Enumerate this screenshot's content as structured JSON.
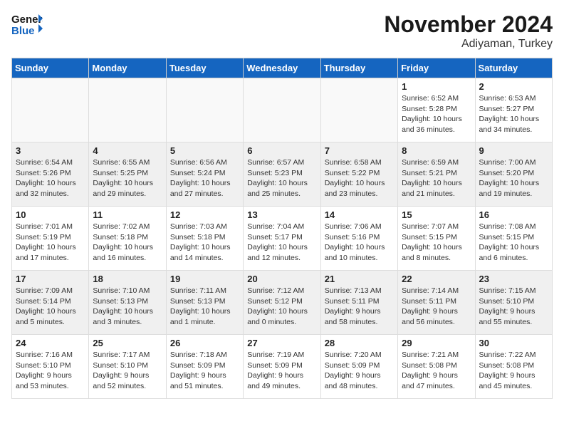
{
  "logo": {
    "general": "General",
    "blue": "Blue"
  },
  "header": {
    "month": "November 2024",
    "location": "Adiyaman, Turkey"
  },
  "weekdays": [
    "Sunday",
    "Monday",
    "Tuesday",
    "Wednesday",
    "Thursday",
    "Friday",
    "Saturday"
  ],
  "weeks": [
    [
      {
        "day": "",
        "info": ""
      },
      {
        "day": "",
        "info": ""
      },
      {
        "day": "",
        "info": ""
      },
      {
        "day": "",
        "info": ""
      },
      {
        "day": "",
        "info": ""
      },
      {
        "day": "1",
        "info": "Sunrise: 6:52 AM\nSunset: 5:28 PM\nDaylight: 10 hours\nand 36 minutes."
      },
      {
        "day": "2",
        "info": "Sunrise: 6:53 AM\nSunset: 5:27 PM\nDaylight: 10 hours\nand 34 minutes."
      }
    ],
    [
      {
        "day": "3",
        "info": "Sunrise: 6:54 AM\nSunset: 5:26 PM\nDaylight: 10 hours\nand 32 minutes."
      },
      {
        "day": "4",
        "info": "Sunrise: 6:55 AM\nSunset: 5:25 PM\nDaylight: 10 hours\nand 29 minutes."
      },
      {
        "day": "5",
        "info": "Sunrise: 6:56 AM\nSunset: 5:24 PM\nDaylight: 10 hours\nand 27 minutes."
      },
      {
        "day": "6",
        "info": "Sunrise: 6:57 AM\nSunset: 5:23 PM\nDaylight: 10 hours\nand 25 minutes."
      },
      {
        "day": "7",
        "info": "Sunrise: 6:58 AM\nSunset: 5:22 PM\nDaylight: 10 hours\nand 23 minutes."
      },
      {
        "day": "8",
        "info": "Sunrise: 6:59 AM\nSunset: 5:21 PM\nDaylight: 10 hours\nand 21 minutes."
      },
      {
        "day": "9",
        "info": "Sunrise: 7:00 AM\nSunset: 5:20 PM\nDaylight: 10 hours\nand 19 minutes."
      }
    ],
    [
      {
        "day": "10",
        "info": "Sunrise: 7:01 AM\nSunset: 5:19 PM\nDaylight: 10 hours\nand 17 minutes."
      },
      {
        "day": "11",
        "info": "Sunrise: 7:02 AM\nSunset: 5:18 PM\nDaylight: 10 hours\nand 16 minutes."
      },
      {
        "day": "12",
        "info": "Sunrise: 7:03 AM\nSunset: 5:18 PM\nDaylight: 10 hours\nand 14 minutes."
      },
      {
        "day": "13",
        "info": "Sunrise: 7:04 AM\nSunset: 5:17 PM\nDaylight: 10 hours\nand 12 minutes."
      },
      {
        "day": "14",
        "info": "Sunrise: 7:06 AM\nSunset: 5:16 PM\nDaylight: 10 hours\nand 10 minutes."
      },
      {
        "day": "15",
        "info": "Sunrise: 7:07 AM\nSunset: 5:15 PM\nDaylight: 10 hours\nand 8 minutes."
      },
      {
        "day": "16",
        "info": "Sunrise: 7:08 AM\nSunset: 5:15 PM\nDaylight: 10 hours\nand 6 minutes."
      }
    ],
    [
      {
        "day": "17",
        "info": "Sunrise: 7:09 AM\nSunset: 5:14 PM\nDaylight: 10 hours\nand 5 minutes."
      },
      {
        "day": "18",
        "info": "Sunrise: 7:10 AM\nSunset: 5:13 PM\nDaylight: 10 hours\nand 3 minutes."
      },
      {
        "day": "19",
        "info": "Sunrise: 7:11 AM\nSunset: 5:13 PM\nDaylight: 10 hours\nand 1 minute."
      },
      {
        "day": "20",
        "info": "Sunrise: 7:12 AM\nSunset: 5:12 PM\nDaylight: 10 hours\nand 0 minutes."
      },
      {
        "day": "21",
        "info": "Sunrise: 7:13 AM\nSunset: 5:11 PM\nDaylight: 9 hours\nand 58 minutes."
      },
      {
        "day": "22",
        "info": "Sunrise: 7:14 AM\nSunset: 5:11 PM\nDaylight: 9 hours\nand 56 minutes."
      },
      {
        "day": "23",
        "info": "Sunrise: 7:15 AM\nSunset: 5:10 PM\nDaylight: 9 hours\nand 55 minutes."
      }
    ],
    [
      {
        "day": "24",
        "info": "Sunrise: 7:16 AM\nSunset: 5:10 PM\nDaylight: 9 hours\nand 53 minutes."
      },
      {
        "day": "25",
        "info": "Sunrise: 7:17 AM\nSunset: 5:10 PM\nDaylight: 9 hours\nand 52 minutes."
      },
      {
        "day": "26",
        "info": "Sunrise: 7:18 AM\nSunset: 5:09 PM\nDaylight: 9 hours\nand 51 minutes."
      },
      {
        "day": "27",
        "info": "Sunrise: 7:19 AM\nSunset: 5:09 PM\nDaylight: 9 hours\nand 49 minutes."
      },
      {
        "day": "28",
        "info": "Sunrise: 7:20 AM\nSunset: 5:09 PM\nDaylight: 9 hours\nand 48 minutes."
      },
      {
        "day": "29",
        "info": "Sunrise: 7:21 AM\nSunset: 5:08 PM\nDaylight: 9 hours\nand 47 minutes."
      },
      {
        "day": "30",
        "info": "Sunrise: 7:22 AM\nSunset: 5:08 PM\nDaylight: 9 hours\nand 45 minutes."
      }
    ]
  ]
}
